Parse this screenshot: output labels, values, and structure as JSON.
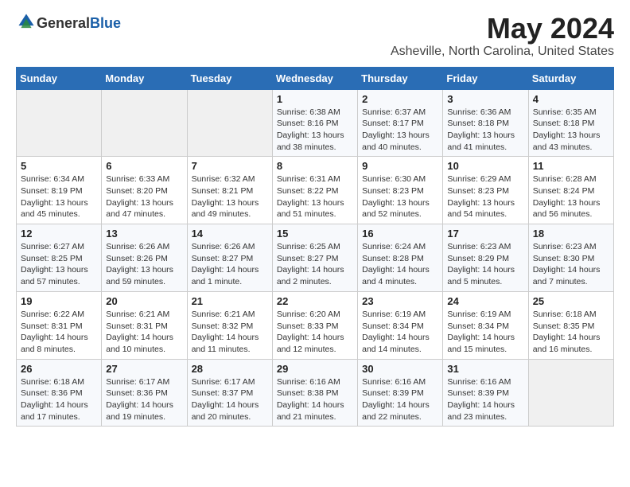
{
  "logo": {
    "text_general": "General",
    "text_blue": "Blue"
  },
  "title": "May 2024",
  "subtitle": "Asheville, North Carolina, United States",
  "days_of_week": [
    "Sunday",
    "Monday",
    "Tuesday",
    "Wednesday",
    "Thursday",
    "Friday",
    "Saturday"
  ],
  "weeks": [
    [
      {
        "day": "",
        "info": ""
      },
      {
        "day": "",
        "info": ""
      },
      {
        "day": "",
        "info": ""
      },
      {
        "day": "1",
        "info": "Sunrise: 6:38 AM\nSunset: 8:16 PM\nDaylight: 13 hours\nand 38 minutes."
      },
      {
        "day": "2",
        "info": "Sunrise: 6:37 AM\nSunset: 8:17 PM\nDaylight: 13 hours\nand 40 minutes."
      },
      {
        "day": "3",
        "info": "Sunrise: 6:36 AM\nSunset: 8:18 PM\nDaylight: 13 hours\nand 41 minutes."
      },
      {
        "day": "4",
        "info": "Sunrise: 6:35 AM\nSunset: 8:18 PM\nDaylight: 13 hours\nand 43 minutes."
      }
    ],
    [
      {
        "day": "5",
        "info": "Sunrise: 6:34 AM\nSunset: 8:19 PM\nDaylight: 13 hours\nand 45 minutes."
      },
      {
        "day": "6",
        "info": "Sunrise: 6:33 AM\nSunset: 8:20 PM\nDaylight: 13 hours\nand 47 minutes."
      },
      {
        "day": "7",
        "info": "Sunrise: 6:32 AM\nSunset: 8:21 PM\nDaylight: 13 hours\nand 49 minutes."
      },
      {
        "day": "8",
        "info": "Sunrise: 6:31 AM\nSunset: 8:22 PM\nDaylight: 13 hours\nand 51 minutes."
      },
      {
        "day": "9",
        "info": "Sunrise: 6:30 AM\nSunset: 8:23 PM\nDaylight: 13 hours\nand 52 minutes."
      },
      {
        "day": "10",
        "info": "Sunrise: 6:29 AM\nSunset: 8:23 PM\nDaylight: 13 hours\nand 54 minutes."
      },
      {
        "day": "11",
        "info": "Sunrise: 6:28 AM\nSunset: 8:24 PM\nDaylight: 13 hours\nand 56 minutes."
      }
    ],
    [
      {
        "day": "12",
        "info": "Sunrise: 6:27 AM\nSunset: 8:25 PM\nDaylight: 13 hours\nand 57 minutes."
      },
      {
        "day": "13",
        "info": "Sunrise: 6:26 AM\nSunset: 8:26 PM\nDaylight: 13 hours\nand 59 minutes."
      },
      {
        "day": "14",
        "info": "Sunrise: 6:26 AM\nSunset: 8:27 PM\nDaylight: 14 hours\nand 1 minute."
      },
      {
        "day": "15",
        "info": "Sunrise: 6:25 AM\nSunset: 8:27 PM\nDaylight: 14 hours\nand 2 minutes."
      },
      {
        "day": "16",
        "info": "Sunrise: 6:24 AM\nSunset: 8:28 PM\nDaylight: 14 hours\nand 4 minutes."
      },
      {
        "day": "17",
        "info": "Sunrise: 6:23 AM\nSunset: 8:29 PM\nDaylight: 14 hours\nand 5 minutes."
      },
      {
        "day": "18",
        "info": "Sunrise: 6:23 AM\nSunset: 8:30 PM\nDaylight: 14 hours\nand 7 minutes."
      }
    ],
    [
      {
        "day": "19",
        "info": "Sunrise: 6:22 AM\nSunset: 8:31 PM\nDaylight: 14 hours\nand 8 minutes."
      },
      {
        "day": "20",
        "info": "Sunrise: 6:21 AM\nSunset: 8:31 PM\nDaylight: 14 hours\nand 10 minutes."
      },
      {
        "day": "21",
        "info": "Sunrise: 6:21 AM\nSunset: 8:32 PM\nDaylight: 14 hours\nand 11 minutes."
      },
      {
        "day": "22",
        "info": "Sunrise: 6:20 AM\nSunset: 8:33 PM\nDaylight: 14 hours\nand 12 minutes."
      },
      {
        "day": "23",
        "info": "Sunrise: 6:19 AM\nSunset: 8:34 PM\nDaylight: 14 hours\nand 14 minutes."
      },
      {
        "day": "24",
        "info": "Sunrise: 6:19 AM\nSunset: 8:34 PM\nDaylight: 14 hours\nand 15 minutes."
      },
      {
        "day": "25",
        "info": "Sunrise: 6:18 AM\nSunset: 8:35 PM\nDaylight: 14 hours\nand 16 minutes."
      }
    ],
    [
      {
        "day": "26",
        "info": "Sunrise: 6:18 AM\nSunset: 8:36 PM\nDaylight: 14 hours\nand 17 minutes."
      },
      {
        "day": "27",
        "info": "Sunrise: 6:17 AM\nSunset: 8:36 PM\nDaylight: 14 hours\nand 19 minutes."
      },
      {
        "day": "28",
        "info": "Sunrise: 6:17 AM\nSunset: 8:37 PM\nDaylight: 14 hours\nand 20 minutes."
      },
      {
        "day": "29",
        "info": "Sunrise: 6:16 AM\nSunset: 8:38 PM\nDaylight: 14 hours\nand 21 minutes."
      },
      {
        "day": "30",
        "info": "Sunrise: 6:16 AM\nSunset: 8:39 PM\nDaylight: 14 hours\nand 22 minutes."
      },
      {
        "day": "31",
        "info": "Sunrise: 6:16 AM\nSunset: 8:39 PM\nDaylight: 14 hours\nand 23 minutes."
      },
      {
        "day": "",
        "info": ""
      }
    ]
  ]
}
